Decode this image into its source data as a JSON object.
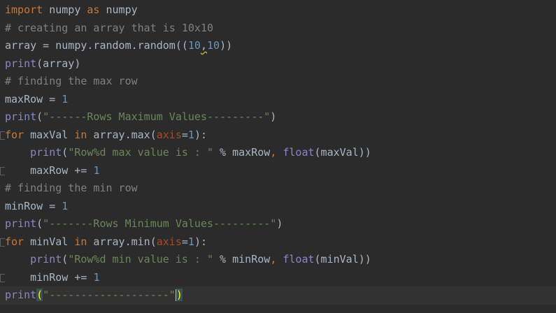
{
  "editor": {
    "lines": [
      {
        "tokens": [
          {
            "t": "kw",
            "v": "import"
          },
          {
            "t": "plain",
            "v": " numpy "
          },
          {
            "t": "kw",
            "v": "as"
          },
          {
            "t": "plain",
            "v": " numpy"
          }
        ]
      },
      {
        "tokens": [
          {
            "t": "cmt",
            "v": "# creating an array that is 10x10"
          }
        ]
      },
      {
        "tokens": [
          {
            "t": "plain",
            "v": "array = numpy.random.random(("
          },
          {
            "t": "num",
            "v": "10"
          },
          {
            "t": "squiggle",
            "v": ","
          },
          {
            "t": "num",
            "v": "10"
          },
          {
            "t": "plain",
            "v": "))"
          }
        ]
      },
      {
        "tokens": [
          {
            "t": "bi",
            "v": "print"
          },
          {
            "t": "plain",
            "v": "(array)"
          }
        ]
      },
      {
        "tokens": [
          {
            "t": "cmt",
            "v": "# finding the max row"
          }
        ]
      },
      {
        "tokens": [
          {
            "t": "plain",
            "v": "maxRow = "
          },
          {
            "t": "num",
            "v": "1"
          }
        ]
      },
      {
        "tokens": [
          {
            "t": "bi",
            "v": "print"
          },
          {
            "t": "plain",
            "v": "("
          },
          {
            "t": "str",
            "v": "\"------Rows Maximum Values---------\""
          },
          {
            "t": "plain",
            "v": ")"
          }
        ]
      },
      {
        "fold": "open",
        "tokens": [
          {
            "t": "kw",
            "v": "for"
          },
          {
            "t": "plain",
            "v": " maxVal "
          },
          {
            "t": "kw",
            "v": "in"
          },
          {
            "t": "plain",
            "v": " array.max("
          },
          {
            "t": "param",
            "v": "axis"
          },
          {
            "t": "plain",
            "v": "="
          },
          {
            "t": "num",
            "v": "1"
          },
          {
            "t": "plain",
            "v": "):"
          }
        ]
      },
      {
        "tokens": [
          {
            "t": "plain",
            "v": "    "
          },
          {
            "t": "bi",
            "v": "print"
          },
          {
            "t": "plain",
            "v": "("
          },
          {
            "t": "str",
            "v": "\"Row%d max value is : \""
          },
          {
            "t": "plain",
            "v": " % maxRow"
          },
          {
            "t": "kw",
            "v": ","
          },
          {
            "t": "plain",
            "v": " "
          },
          {
            "t": "bi",
            "v": "float"
          },
          {
            "t": "plain",
            "v": "(maxVal))"
          }
        ]
      },
      {
        "fold": "close",
        "tokens": [
          {
            "t": "plain",
            "v": "    maxRow += "
          },
          {
            "t": "num",
            "v": "1"
          }
        ]
      },
      {
        "tokens": [
          {
            "t": "cmt",
            "v": "# finding the min row"
          }
        ]
      },
      {
        "tokens": [
          {
            "t": "plain",
            "v": "minRow = "
          },
          {
            "t": "num",
            "v": "1"
          }
        ]
      },
      {
        "tokens": [
          {
            "t": "bi",
            "v": "print"
          },
          {
            "t": "plain",
            "v": "("
          },
          {
            "t": "str",
            "v": "\"-------Rows Minimum Values---------\""
          },
          {
            "t": "plain",
            "v": ")"
          }
        ]
      },
      {
        "fold": "open",
        "tokens": [
          {
            "t": "kw",
            "v": "for"
          },
          {
            "t": "plain",
            "v": " minVal "
          },
          {
            "t": "kw",
            "v": "in"
          },
          {
            "t": "plain",
            "v": " array.min("
          },
          {
            "t": "param",
            "v": "axis"
          },
          {
            "t": "plain",
            "v": "="
          },
          {
            "t": "num",
            "v": "1"
          },
          {
            "t": "plain",
            "v": "):"
          }
        ]
      },
      {
        "tokens": [
          {
            "t": "plain",
            "v": "    "
          },
          {
            "t": "bi",
            "v": "print"
          },
          {
            "t": "plain",
            "v": "("
          },
          {
            "t": "str",
            "v": "\"Row%d min value is : \""
          },
          {
            "t": "plain",
            "v": " % minRow"
          },
          {
            "t": "kw",
            "v": ","
          },
          {
            "t": "plain",
            "v": " "
          },
          {
            "t": "bi",
            "v": "float"
          },
          {
            "t": "plain",
            "v": "(minVal))"
          }
        ]
      },
      {
        "fold": "close",
        "tokens": [
          {
            "t": "plain",
            "v": "    minRow += "
          },
          {
            "t": "num",
            "v": "1"
          }
        ]
      },
      {
        "current": true,
        "tokens": [
          {
            "t": "bi",
            "v": "print"
          },
          {
            "t": "paren-hl",
            "v": "("
          },
          {
            "t": "str",
            "v": "\"-------------------\""
          },
          {
            "t": "caret",
            "v": ""
          },
          {
            "t": "paren-hl",
            "v": ")"
          }
        ]
      }
    ]
  },
  "colors": {
    "background": "#2b2b2b",
    "keyword": "#cc7832",
    "builtin": "#8888c6",
    "number": "#6897bb",
    "string": "#6a8759",
    "comment": "#808080",
    "parameter": "#aa4926",
    "text": "#a9b7c6"
  }
}
